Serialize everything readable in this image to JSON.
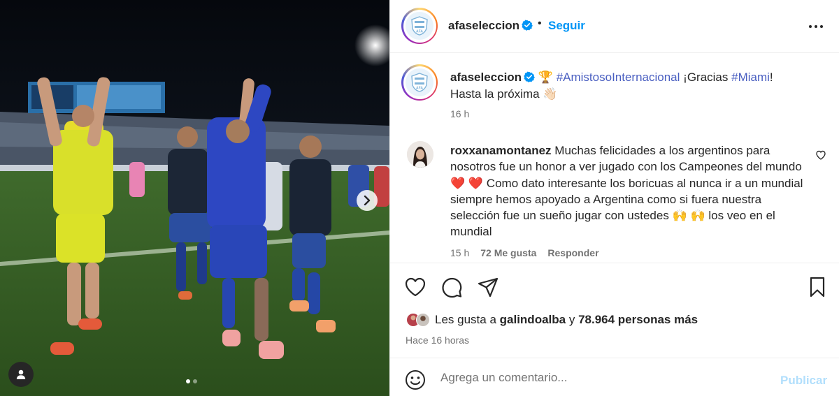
{
  "post": {
    "username": "afaseleccion",
    "separator": "•",
    "follow_label": "Seguir",
    "caption_hashtag1": "#AmistosoInternacional",
    "caption_text1": "¡Gracias",
    "caption_hashtag2": "#Miami",
    "caption_text2": "!",
    "caption_line2": "Hasta la próxima",
    "caption_time": "16 h",
    "liked_by_label": "Les gusta a",
    "liked_by_user": "galindoalba",
    "liked_and": "y",
    "liked_others": "78.964 personas más",
    "time_ago": "Hace 16 horas",
    "media_total": 2,
    "media_index": 1
  },
  "comment": {
    "username": "roxxanamontanez",
    "text_part1": "Muchas felicidades a los argentinos para nosotros fue un honor a ver jugado con los Campeones del mundo",
    "text_part2": "Como dato interesante los boricuas al nunca ir a un mundial siempre hemos apoyado a Argentina como si fuera nuestra selección fue un sueño jugar con ustedes",
    "text_part3": "los veo en el mundial",
    "time": "15 h",
    "likes": "72 Me gusta",
    "reply_label": "Responder"
  },
  "compose": {
    "placeholder": "Agrega un comentario...",
    "post_label": "Publicar"
  },
  "icons": {
    "verified": "verified-badge-icon",
    "more": "more-options-icon",
    "like": "heart-icon",
    "comment": "comment-icon",
    "share": "share-icon",
    "save": "bookmark-icon",
    "emoji": "emoji-icon",
    "next": "chevron-right-icon",
    "user_tag": "user-tag-icon",
    "trophy": "trophy-emoji",
    "wave": "waving-hand-emoji",
    "hearts": "red-heart-emoji",
    "praise": "raising-hands-emoji"
  },
  "colors": {
    "link_blue": "#0095f6",
    "hashtag_blue": "#4a5fc1",
    "secondary_text": "#737373",
    "post_disabled": "#b2dffc",
    "verified_blue": "#0095f6"
  }
}
